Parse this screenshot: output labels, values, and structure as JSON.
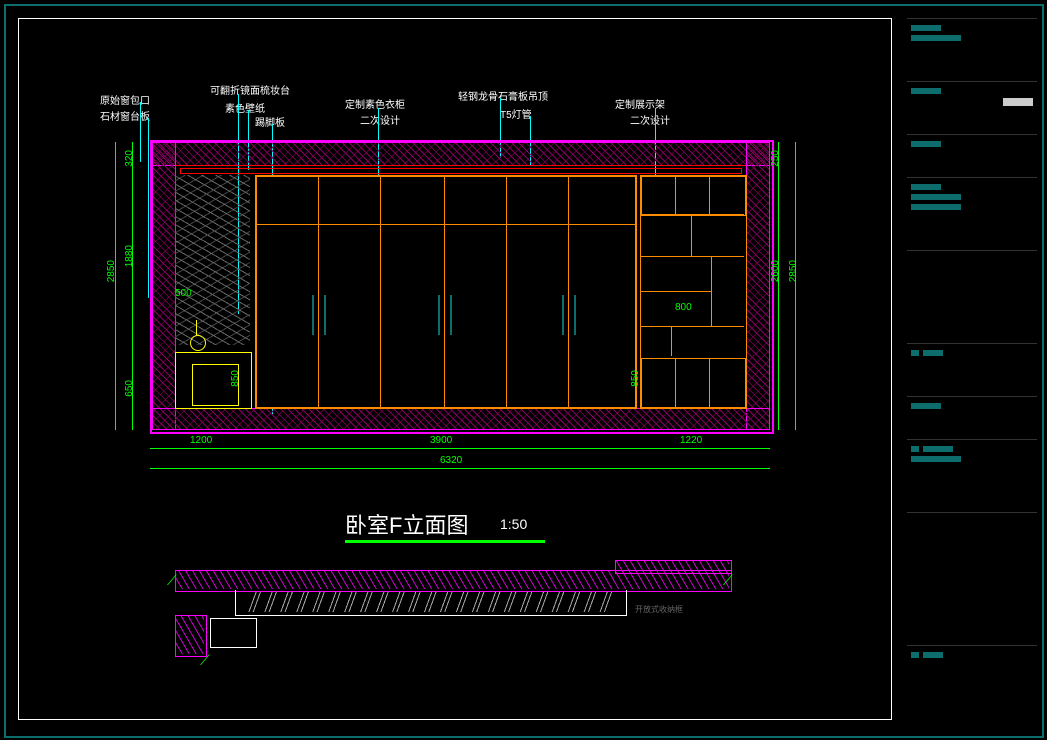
{
  "title": {
    "main": "卧室F立面图",
    "scale": "1:50"
  },
  "labels": {
    "l1": "原始窗包口",
    "l2": "石材窗台板",
    "l3": "可翻折镜面梳妆台",
    "l4": "素色壁纸",
    "l5": "踢脚板",
    "l6": "定制素色衣柜",
    "l7": "二次设计",
    "l8": "轻钢龙骨石膏板吊顶",
    "l9": "T5灯管",
    "l10": "定制展示架",
    "l11": "二次设计",
    "plan_note": "开放式收纳框"
  },
  "dims": {
    "h_total": "6320",
    "h1": "1200",
    "h2": "3900",
    "h3": "1220",
    "v_left_total": "2850",
    "v_left_1": "650",
    "v_left_2": "1880",
    "v_left_3": "320",
    "v_right_total": "2850",
    "v_right_1": "2600",
    "v_right_2": "250",
    "v_mid": "850",
    "d500": "500",
    "d850": "850",
    "d800": "800"
  },
  "chart_data": {
    "type": "table",
    "description": "Interior elevation drawing - Bedroom F",
    "scale": "1:50",
    "overall_width_mm": 6320,
    "overall_height_mm": 2850,
    "segments_horizontal_mm": [
      1200,
      3900,
      1220
    ],
    "segments_vertical_left_mm": [
      650,
      1880,
      320
    ],
    "segments_vertical_right_mm": [
      2600,
      250
    ],
    "internal_dims_mm": {
      "desk_width": 500,
      "desk_height": 850,
      "counter_height": 850,
      "shelf_width": 800
    },
    "callouts": [
      "原始窗包口",
      "石材窗台板",
      "可翻折镜面梳妆台",
      "素色壁纸",
      "踢脚板",
      "定制素色衣柜",
      "二次设计",
      "轻钢龙骨石膏板吊顶",
      "T5灯管",
      "定制展示架",
      "二次设计"
    ]
  }
}
